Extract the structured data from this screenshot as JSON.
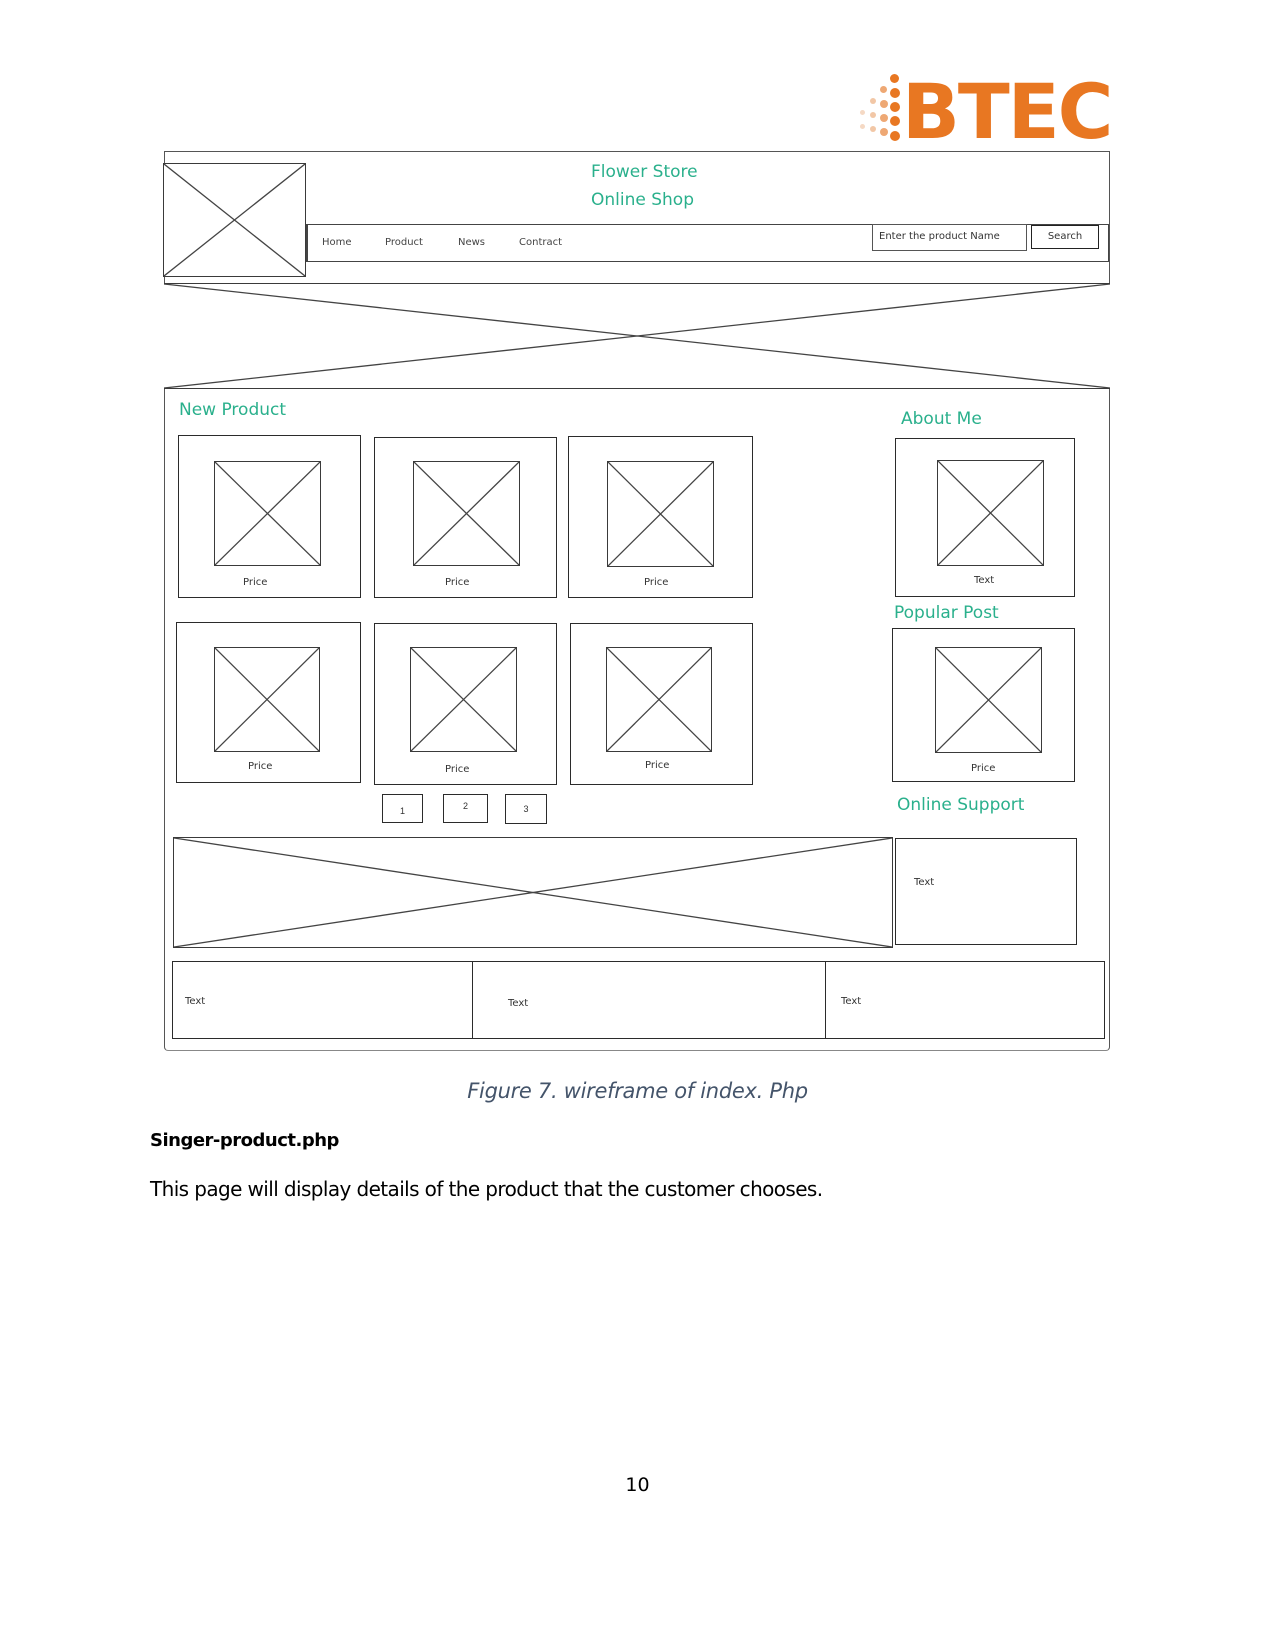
{
  "logo": {
    "text": "BTEC",
    "color": "#e87722"
  },
  "wireframe": {
    "site_title_line1": "Flower Store",
    "site_title_line2": "Online Shop",
    "nav": [
      "Home",
      "Product",
      "News",
      "Contract"
    ],
    "search": {
      "placeholder": "Enter the product Name",
      "button_label": "Search"
    },
    "new_product": {
      "heading": "New Product",
      "items": [
        {
          "label": "Price"
        },
        {
          "label": "Price"
        },
        {
          "label": "Price"
        },
        {
          "label": "Price"
        },
        {
          "label": "Price"
        },
        {
          "label": "Price"
        }
      ],
      "pagination": [
        "1",
        "2",
        "3"
      ]
    },
    "sidebar": {
      "about_heading": "About Me",
      "about_label": "Text",
      "popular_heading": "Popular Post",
      "popular_label": "Price",
      "support_heading": "Online Support",
      "support_label": "Text"
    },
    "footer": [
      "Text",
      "Text",
      "Text"
    ],
    "accent_color": "#2ab08c"
  },
  "caption": "Figure 7. wireframe of index. Php",
  "section_heading": "Singer-product.php",
  "paragraph": "This page will display details of the product that the customer chooses.",
  "page_number": "10"
}
